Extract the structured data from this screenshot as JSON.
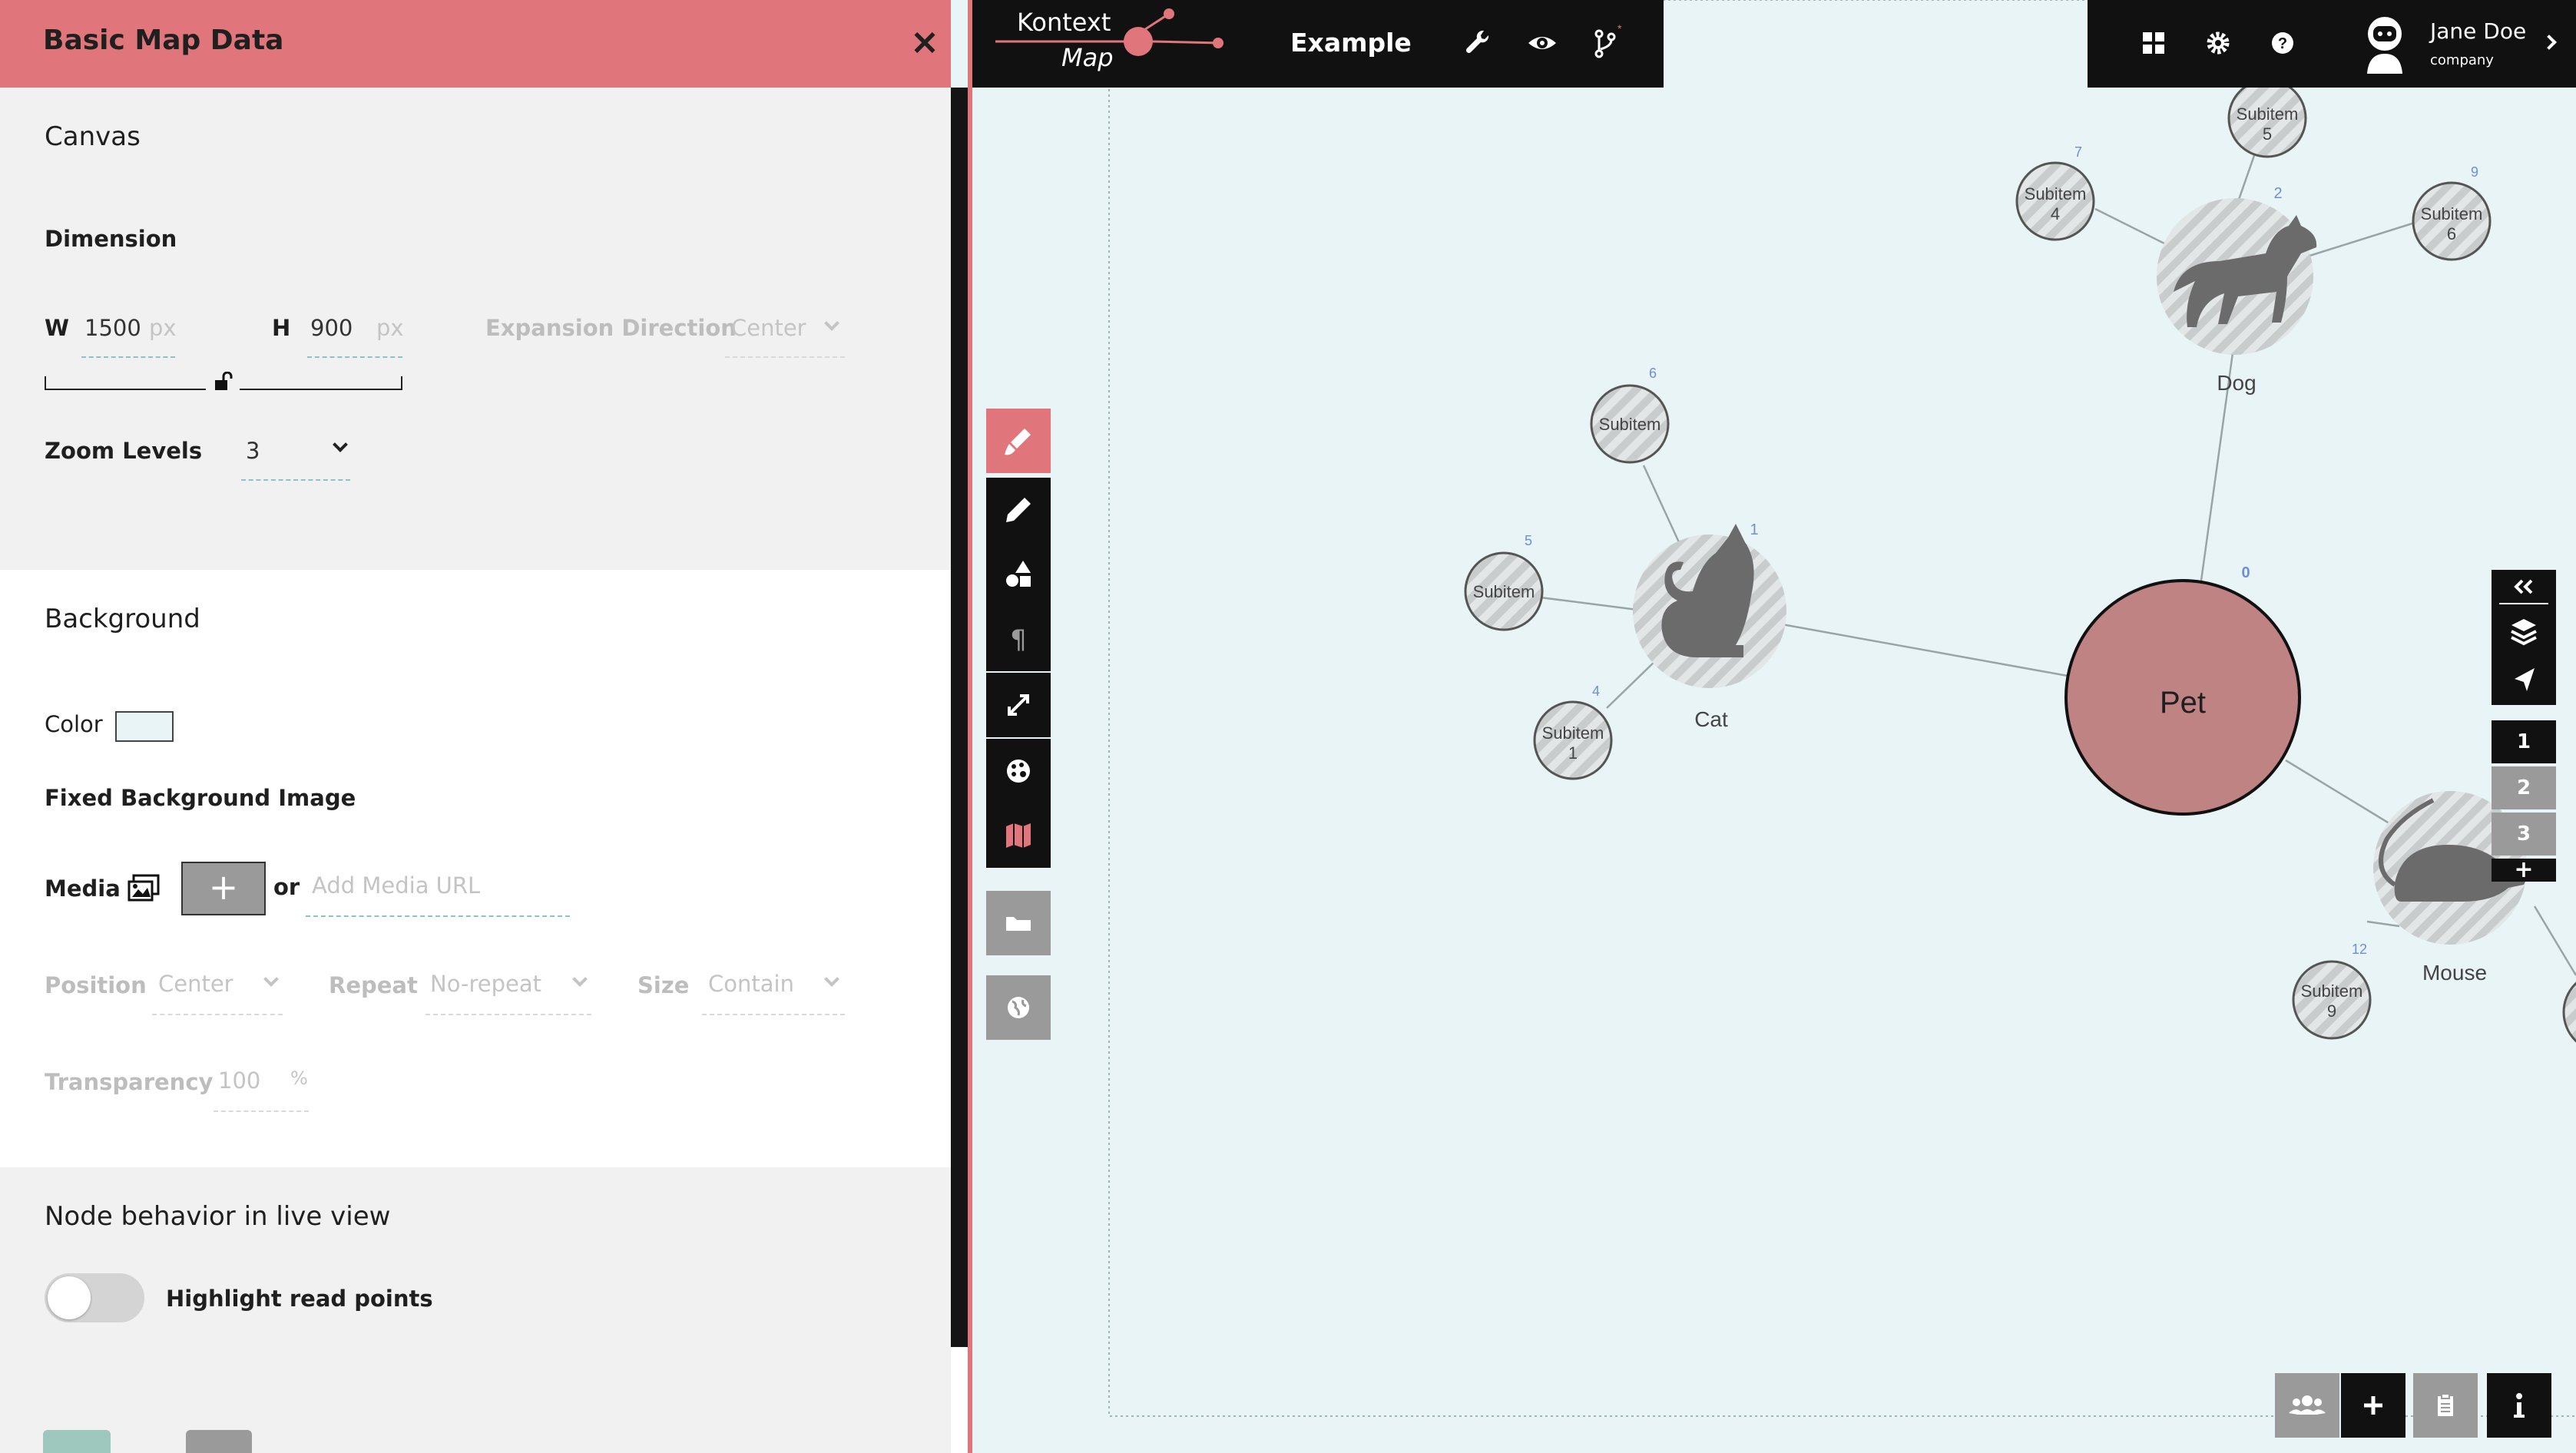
{
  "panel": {
    "title": "Basic Map Data",
    "close_label": "×",
    "canvas": {
      "heading": "Canvas",
      "dimension_label": "Dimension",
      "width_label": "W",
      "width_value": "1500",
      "height_label": "H",
      "height_value": "900",
      "unit": "px",
      "expansion_label": "Expansion Direction",
      "expansion_value": "Center",
      "zoom_label": "Zoom Levels",
      "zoom_value": "3"
    },
    "background": {
      "heading": "Background",
      "color_label": "Color",
      "color_value": "#e8f4f5",
      "fixed_image_label": "Fixed Background Image",
      "media_label": "Media",
      "add_label": "+",
      "or_label": "or",
      "url_placeholder": "Add Media URL",
      "position_label": "Position",
      "position_value": "Center",
      "repeat_label": "Repeat",
      "repeat_value": "No-repeat",
      "size_label": "Size",
      "size_value": "Contain",
      "transparency_label": "Transparency",
      "transparency_value": "100",
      "transparency_unit": "%"
    },
    "node_behavior": {
      "heading": "Node behavior in live view",
      "toggle_label": "Highlight read points",
      "toggle_on": false
    }
  },
  "topbar": {
    "logo_line1": "Kontext",
    "logo_line2": "Map",
    "map_title": "Example",
    "icons": [
      "wrench-icon",
      "eye-icon",
      "branch-icon"
    ]
  },
  "user": {
    "name": "Jane Doe",
    "company": "company",
    "icons": [
      "grid-icon",
      "gear-icon",
      "help-icon",
      "avatar",
      "chevron-right-icon"
    ]
  },
  "colors": {
    "accent": "#e0767b",
    "dark": "#111111",
    "grey": "#9a9a9a",
    "canvas_bg": "#e8f4f5",
    "pet_node": "#bf8384",
    "edge": "#9aa4a4",
    "number": "#6e8ed8"
  },
  "map": {
    "root": {
      "label": "Pet",
      "number": "0"
    },
    "nodes": [
      {
        "label": "Cat",
        "number": "1"
      },
      {
        "label": "Dog",
        "number": "2"
      },
      {
        "label": "Mouse",
        "number": ""
      }
    ],
    "subitems": [
      {
        "line1": "Subitem",
        "line2": "5",
        "number": ""
      },
      {
        "line1": "Subitem",
        "line2": "4",
        "number": "7"
      },
      {
        "line1": "Subitem",
        "line2": "6",
        "number": "9"
      },
      {
        "line1": "Subitem",
        "line2": "",
        "number": "6"
      },
      {
        "line1": "Subitem",
        "line2": "",
        "number": "5"
      },
      {
        "line1": "Subitem",
        "line2": "1",
        "number": "4"
      },
      {
        "line1": "Subitem",
        "line2": "9",
        "number": "12"
      }
    ]
  },
  "left_tools": [
    "brush-icon",
    "pencil-icon",
    "shapes-icon",
    "paragraph-icon",
    "expand-icon",
    "palette-icon",
    "map-icon",
    "folder-icon",
    "globe-icon"
  ],
  "right_tools": {
    "icons": [
      "collapse-icon",
      "layers-icon",
      "navigate-icon"
    ],
    "levels": [
      "1",
      "2",
      "3"
    ],
    "add_label": "+"
  },
  "bottom_tools": [
    "users-icon",
    "add-icon",
    "clipboard-icon",
    "info-icon"
  ]
}
